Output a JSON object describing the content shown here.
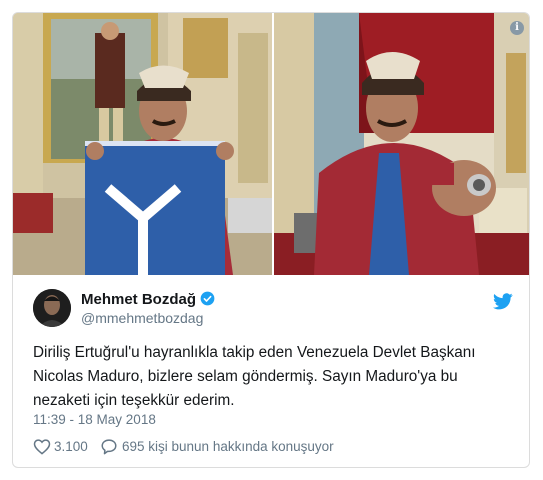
{
  "tweet": {
    "display_name": "Mehmet Bozdağ",
    "handle": "@mmehmetbozdag",
    "verified": true,
    "text_lines": [
      "Diriliş Ertuğrul'u hayranlıkla takip eden Venezuela Devlet Başkanı",
      "Nicolas Maduro, bizlere selam göndermiş. Sayın Maduro'ya  bu",
      "nezaketi için teşekkür ederim."
    ],
    "timestamp": "11:39 - 18 May 2018",
    "like_count": "3.100",
    "reply_text": "695 kişi bunun hakkında konuşuyor"
  },
  "icons": {
    "info": "info-icon",
    "twitter_logo": "twitter-bird-icon",
    "like": "heart-icon",
    "reply": "speech-bubble-icon",
    "verified": "verified-badge-icon"
  },
  "info_glyph": "i",
  "colors": {
    "verified": "#1da1f2",
    "bird": "#1da1f2",
    "text": "#14171a",
    "muted": "#657786"
  }
}
